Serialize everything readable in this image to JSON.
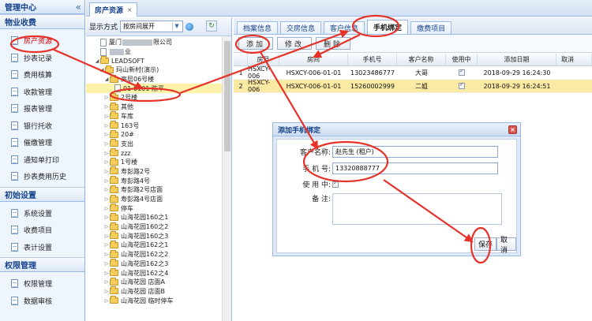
{
  "left_panel": {
    "title": "管理中心",
    "collapse_glyph": "«",
    "sections": [
      {
        "title": "物业收费",
        "items": [
          "房产资源",
          "抄表记录",
          "费用核算",
          "收款管理",
          "报表管理",
          "银行托收",
          "催缴管理",
          "通知单打印",
          "抄表费用历史"
        ]
      },
      {
        "title": "初始设置",
        "items": [
          "系统设置",
          "收费项目",
          "表计设置"
        ]
      },
      {
        "title": "权限管理",
        "items": [
          "权限管理",
          "数据审核"
        ]
      }
    ]
  },
  "main_tab": {
    "label": "房产资源",
    "close": "×"
  },
  "tree_panel": {
    "display_mode_label": "显示方式",
    "display_mode_value": "按房间展开",
    "nodes": [
      {
        "text_pre": "厦门",
        "text_post": "限公司",
        "indent": 1,
        "type": "page",
        "blur": "long"
      },
      {
        "text_pre": "",
        "text_post": "业",
        "indent": 1,
        "type": "page",
        "blur": "short"
      },
      {
        "text_pre": "LEADSOFT",
        "text_post": "",
        "indent": 1,
        "type": "folder",
        "expanded": true
      },
      {
        "text_pre": "玛山新村(演示)",
        "text_post": "",
        "indent": 2,
        "type": "folder",
        "expanded": true
      },
      {
        "text_pre": "高层06号楼",
        "text_post": "",
        "indent": 3,
        "type": "folder",
        "expanded": true
      },
      {
        "text_pre": "01-0101 陈平",
        "text_post": "",
        "indent": 4,
        "type": "page",
        "selected": true
      },
      {
        "text_pre": "2号楼",
        "text_post": "",
        "indent": 3,
        "type": "folder"
      },
      {
        "text_pre": "其他",
        "text_post": "",
        "indent": 3,
        "type": "folder"
      },
      {
        "text_pre": "车库",
        "text_post": "",
        "indent": 3,
        "type": "folder"
      },
      {
        "text_pre": "163号",
        "text_post": "",
        "indent": 3,
        "type": "folder"
      },
      {
        "text_pre": "20#",
        "text_post": "",
        "indent": 3,
        "type": "folder"
      },
      {
        "text_pre": "支出",
        "text_post": "",
        "indent": 3,
        "type": "folder"
      },
      {
        "text_pre": "zzz",
        "text_post": "",
        "indent": 3,
        "type": "folder"
      },
      {
        "text_pre": "1号楼",
        "text_post": "",
        "indent": 3,
        "type": "folder"
      },
      {
        "text_pre": "寿彭路2号",
        "text_post": "",
        "indent": 3,
        "type": "folder"
      },
      {
        "text_pre": "寿彭路4号",
        "text_post": "",
        "indent": 3,
        "type": "folder"
      },
      {
        "text_pre": "寿彭路2号店面",
        "text_post": "",
        "indent": 3,
        "type": "folder"
      },
      {
        "text_pre": "寿彭路4号店面",
        "text_post": "",
        "indent": 3,
        "type": "folder"
      },
      {
        "text_pre": "停车",
        "text_post": "",
        "indent": 3,
        "type": "folder"
      },
      {
        "text_pre": "山海花园160之1",
        "text_post": "",
        "indent": 3,
        "type": "folder"
      },
      {
        "text_pre": "山海花园160之2",
        "text_post": "",
        "indent": 3,
        "type": "folder"
      },
      {
        "text_pre": "山海花园160之3",
        "text_post": "",
        "indent": 3,
        "type": "folder"
      },
      {
        "text_pre": "山海花园162之1",
        "text_post": "",
        "indent": 3,
        "type": "folder"
      },
      {
        "text_pre": "山海花园162之2",
        "text_post": "",
        "indent": 3,
        "type": "folder"
      },
      {
        "text_pre": "山海花园162之3",
        "text_post": "",
        "indent": 3,
        "type": "folder"
      },
      {
        "text_pre": "山海花园162之4",
        "text_post": "",
        "indent": 3,
        "type": "folder"
      },
      {
        "text_pre": "山海花园 店面A",
        "text_post": "",
        "indent": 3,
        "type": "folder"
      },
      {
        "text_pre": "山海花园 店面B",
        "text_post": "",
        "indent": 3,
        "type": "folder"
      },
      {
        "text_pre": "山海花园 临时停车",
        "text_post": "",
        "indent": 3,
        "type": "folder"
      }
    ]
  },
  "detail_panel": {
    "tabs": [
      "档案信息",
      "交房信息",
      "客户信息",
      "手机绑定",
      "缴费项目"
    ],
    "active_tab": 3,
    "actions": [
      "添加",
      "修改",
      "删除"
    ],
    "columns": [
      "",
      "房号",
      "房间",
      "手机号",
      "客户名称",
      "使用中",
      "添加日期",
      "取消"
    ],
    "rows": [
      {
        "idx": "1",
        "house": "HSXCY-006",
        "room": "HSXCY-006-01-01",
        "phone": "13023486777",
        "name": "大哥",
        "in_use": true,
        "date": "2018-09-29 16:24:30",
        "cancel": ""
      },
      {
        "idx": "2",
        "house": "HSXCY-006",
        "room": "HSXCY-006-01-01",
        "phone": "15260002999",
        "name": "二姐",
        "in_use": true,
        "date": "2018-09-29 16:24:51",
        "cancel": "",
        "selected": true
      }
    ]
  },
  "dialog": {
    "title": "添加手机绑定",
    "close": "×",
    "fields": {
      "customer_label": "客户名称:",
      "customer_value": "赵先生 (租户)",
      "phone_label": "手 机 号:",
      "phone_value": "13320888777",
      "inuse_label": "使 用 中:",
      "inuse_checked": true,
      "note_label": "备    注:",
      "note_value": ""
    },
    "save_label": "保存",
    "cancel_label": "取消"
  },
  "annotation_color": "#e5332a"
}
